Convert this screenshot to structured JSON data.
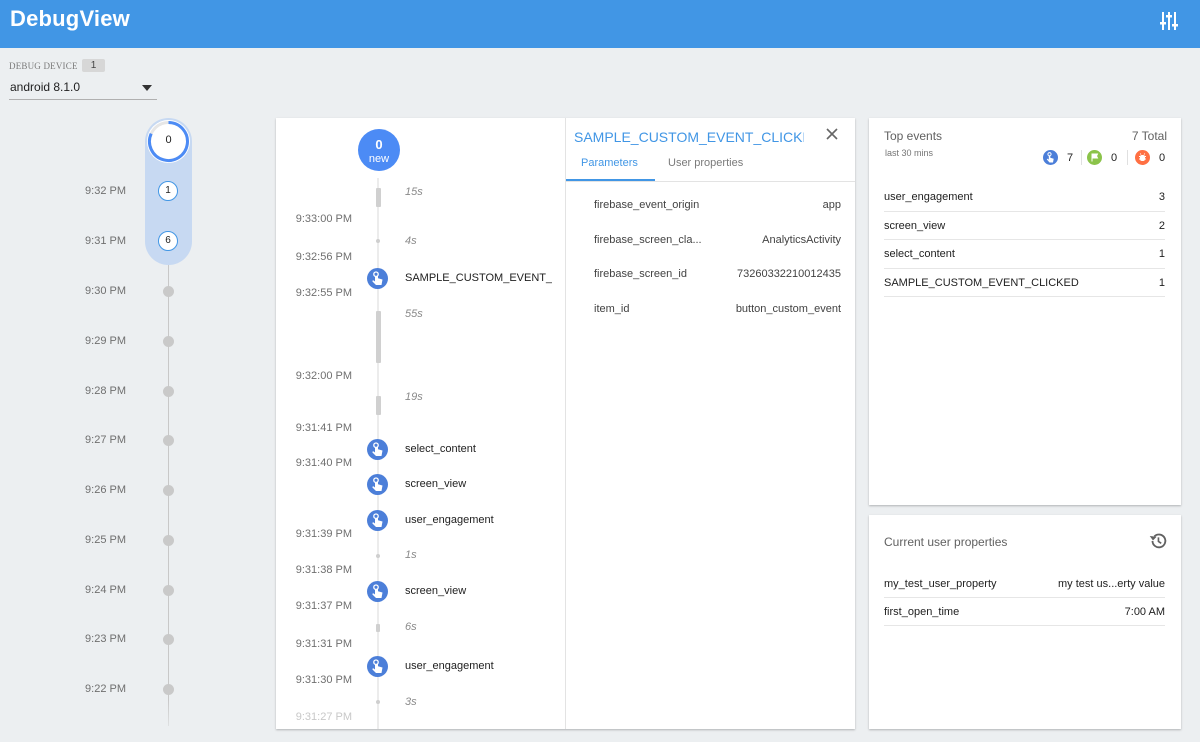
{
  "app": {
    "title": "DebugView"
  },
  "device": {
    "label": "DEBUG DEVICE",
    "count": "1",
    "selected": "android 8.1.0"
  },
  "minutes": {
    "top_count": "0",
    "items": [
      {
        "time": "9:32 PM",
        "count": "1"
      },
      {
        "time": "9:31 PM",
        "count": "6"
      },
      {
        "time": "9:30 PM"
      },
      {
        "time": "9:29 PM"
      },
      {
        "time": "9:28 PM"
      },
      {
        "time": "9:27 PM"
      },
      {
        "time": "9:26 PM"
      },
      {
        "time": "9:25 PM"
      },
      {
        "time": "9:24 PM"
      },
      {
        "time": "9:23 PM"
      },
      {
        "time": "9:22 PM"
      }
    ]
  },
  "stream": {
    "new_count": "0",
    "new_label": "new",
    "times": [
      "9:33:00 PM",
      "9:32:56 PM",
      "9:32:55 PM",
      "9:32:00 PM",
      "9:31:41 PM",
      "9:31:40 PM",
      "9:31:39 PM",
      "9:31:38 PM",
      "9:31:37 PM",
      "9:31:31 PM",
      "9:31:30 PM",
      "9:31:27 PM"
    ],
    "gaps": [
      "15s",
      "4s",
      "55s",
      "19s",
      "1s",
      "6s",
      "3s"
    ],
    "events": [
      "SAMPLE_CUSTOM_EVENT_CLICKED",
      "select_content",
      "screen_view",
      "user_engagement",
      "screen_view",
      "user_engagement"
    ]
  },
  "detail": {
    "title": "SAMPLE_CUSTOM_EVENT_CLICKED",
    "tabs": [
      "Parameters",
      "User properties"
    ],
    "params": [
      {
        "key": "firebase_event_origin",
        "value": "app"
      },
      {
        "key": "firebase_screen_cla...",
        "value": "AnalyticsActivity"
      },
      {
        "key": "firebase_screen_id",
        "value": "73260332210012435"
      },
      {
        "key": "item_id",
        "value": "button_custom_event"
      }
    ]
  },
  "top_events": {
    "title": "Top events",
    "subtitle": "last 30 mins",
    "total": "7 Total",
    "type_counts": {
      "conversion_touch": "7",
      "flag": "0",
      "error": "0"
    },
    "type_colors": {
      "touch": "#4c7fd9",
      "flag": "#8bc34a",
      "error": "#ff7043"
    },
    "rows": [
      {
        "name": "user_engagement",
        "count": "3"
      },
      {
        "name": "screen_view",
        "count": "2"
      },
      {
        "name": "select_content",
        "count": "1"
      },
      {
        "name": "SAMPLE_CUSTOM_EVENT_CLICKED",
        "count": "1"
      }
    ]
  },
  "user_properties": {
    "title": "Current user properties",
    "rows": [
      {
        "name": "my_test_user_property",
        "value": "my test us...erty value"
      },
      {
        "name": "first_open_time",
        "value": "7:00 AM"
      }
    ]
  }
}
